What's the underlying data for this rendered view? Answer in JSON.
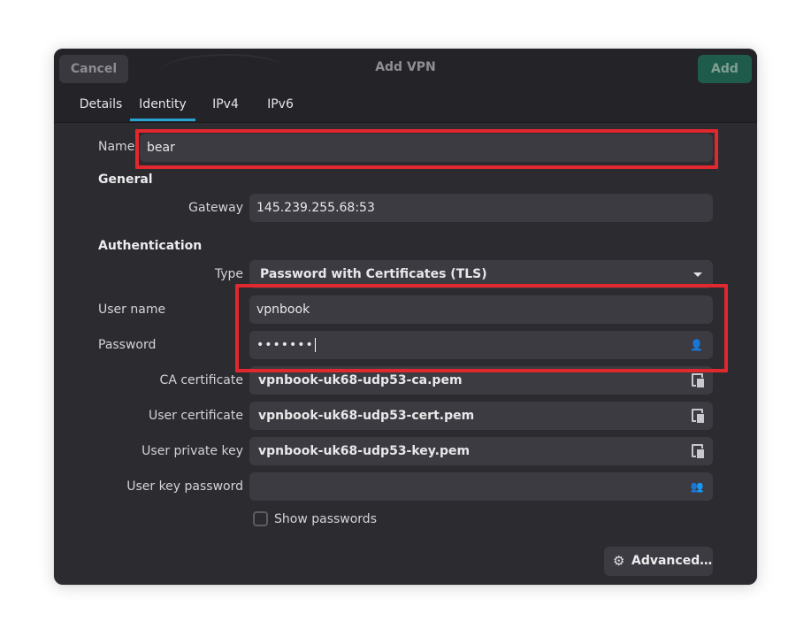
{
  "header": {
    "cancel_label": "Cancel",
    "title": "Add VPN",
    "add_label": "Add"
  },
  "tabs": [
    {
      "label": "Details",
      "active": false
    },
    {
      "label": "Identity",
      "active": true
    },
    {
      "label": "IPv4",
      "active": false
    },
    {
      "label": "IPv6",
      "active": false
    }
  ],
  "form": {
    "name": {
      "label": "Name",
      "value": "bear"
    },
    "general": {
      "heading": "General",
      "gateway": {
        "label": "Gateway",
        "value": "145.239.255.68:53"
      }
    },
    "authentication": {
      "heading": "Authentication",
      "type": {
        "label": "Type",
        "value": "Password with Certificates (TLS)"
      },
      "username": {
        "label": "User name",
        "value": "vpnbook"
      },
      "password": {
        "label": "Password",
        "value": "•••••••"
      },
      "ca_certificate": {
        "label": "CA certificate",
        "value": "vpnbook-uk68-udp53-ca.pem"
      },
      "user_certificate": {
        "label": "User certificate",
        "value": "vpnbook-uk68-udp53-cert.pem"
      },
      "user_private_key": {
        "label": "User private key",
        "value": "vpnbook-uk68-udp53-key.pem"
      },
      "user_key_password": {
        "label": "User key password",
        "value": ""
      }
    },
    "show_passwords": {
      "label": "Show passwords",
      "checked": false
    },
    "advanced_label": "Advanced…"
  },
  "icons": {
    "password_mode": "user-lock-icon",
    "file_chooser": "document-open-icon",
    "key_password_mode": "users-icon",
    "advanced": "gear-icon",
    "dropdown": "chevron-down-icon"
  },
  "colors": {
    "dialog_bg": "#2b2b30",
    "field_bg": "#3b3b41",
    "accent_tab": "#27a4d0",
    "add_button": "#1f5b4b",
    "highlight": "#e0282e"
  }
}
